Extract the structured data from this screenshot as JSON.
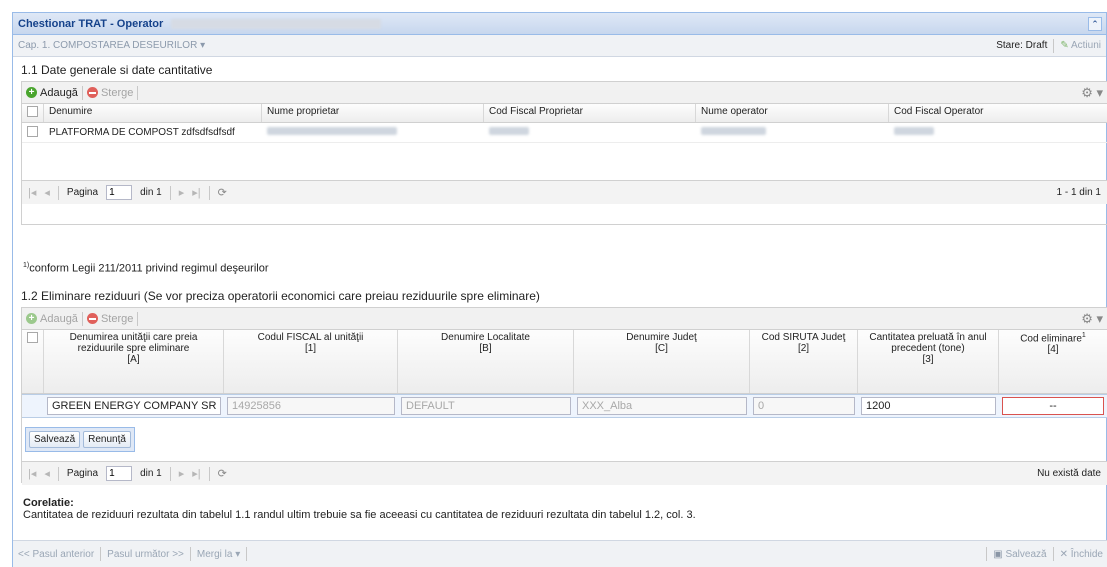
{
  "window": {
    "title": "Chestionar TRAT - Operator",
    "collapse_icon": "chevron-up-icon"
  },
  "chapter": {
    "label": "Cap. 1. COMPOSTAREA DESEURILOR",
    "stare": "Stare: Draft",
    "actiuni": "Actiuni"
  },
  "section1": {
    "title": "1.1 Date generale si date cantitative",
    "toolbar": {
      "add": "Adaugă",
      "delete": "Sterge"
    },
    "columns": [
      "Denumire",
      "Nume proprietar",
      "Cod Fiscal Proprietar",
      "Nume operator",
      "Cod Fiscal Operator"
    ],
    "rows": [
      {
        "denumire": "PLATFORMA DE COMPOST zdfsdfsdfsdf"
      }
    ],
    "pager": {
      "page_label": "Pagina",
      "page_value": "1",
      "of_label": "din 1",
      "summary": "1 - 1 din 1"
    }
  },
  "footnote": {
    "sup": "1)",
    "text": "conform Legii 211/2011 privind regimul deşeurilor"
  },
  "section2": {
    "title": "1.2 Eliminare reziduuri (Se vor preciza operatorii economici care preiau reziduurile spre eliminare)",
    "toolbar": {
      "add": "Adaugă",
      "delete": "Sterge"
    },
    "columns": [
      {
        "label": "Denumirea unităţii care preia reziduurile spre eliminare",
        "code": "[A]"
      },
      {
        "label": "Codul FISCAL al unităţii",
        "code": "[1]"
      },
      {
        "label": "Denumire Localitate",
        "code": "[B]"
      },
      {
        "label": "Denumire Judeţ",
        "code": "[C]"
      },
      {
        "label": "Cod SIRUTA Judeţ",
        "code": "[2]"
      },
      {
        "label": "Cantitatea preluată în anul precedent (tone)",
        "code": "[3]"
      },
      {
        "label": "Cod eliminare",
        "sup": "1",
        "code": "[4]"
      }
    ],
    "editor": {
      "denumire": "GREEN ENERGY COMPANY SRL",
      "cod_fiscal": "14925856",
      "localitate": "DEFAULT",
      "judet": "XXX_Alba",
      "siruta": "0",
      "cantitate": "1200",
      "cod_eliminare": "--"
    },
    "row_buttons": {
      "save": "Salvează",
      "cancel": "Renunţă"
    },
    "pager": {
      "page_label": "Pagina",
      "page_value": "1",
      "of_label": "din 1",
      "summary": "Nu există date"
    }
  },
  "corelatie": {
    "heading": "Corelatie:",
    "text": "Cantitatea de reziduuri rezultata din tabelul 1.1 randul ultim trebuie sa fie aceeasi cu cantitatea de reziduuri rezultata din tabelul 1.2, col. 3."
  },
  "bottom": {
    "prev": "<< Pasul anterior",
    "next": "Pasul următor >>",
    "goto": "Mergi la",
    "save": "Salvează",
    "close": "Închide"
  }
}
